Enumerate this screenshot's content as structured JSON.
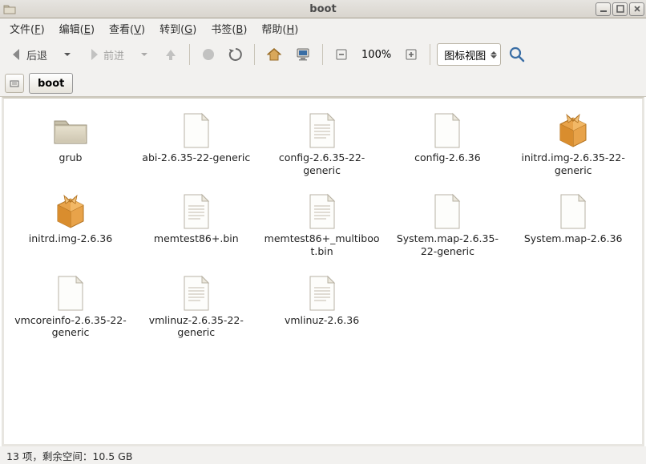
{
  "window": {
    "title": "boot"
  },
  "menu": {
    "items": [
      {
        "label": "文件",
        "accel": "F"
      },
      {
        "label": "编辑",
        "accel": "E"
      },
      {
        "label": "查看",
        "accel": "V"
      },
      {
        "label": "转到",
        "accel": "G"
      },
      {
        "label": "书签",
        "accel": "B"
      },
      {
        "label": "帮助",
        "accel": "H"
      }
    ]
  },
  "toolbar": {
    "back_label": "后退",
    "forward_label": "前进",
    "zoom_level": "100%",
    "view_mode": "图标视图"
  },
  "location": {
    "breadcrumb": "boot"
  },
  "files": [
    {
      "name": "grub",
      "type": "folder"
    },
    {
      "name": "abi-2.6.35-22-generic",
      "type": "file"
    },
    {
      "name": "config-2.6.35-22-generic",
      "type": "text"
    },
    {
      "name": "config-2.6.36",
      "type": "file"
    },
    {
      "name": "initrd.img-2.6.35-22-generic",
      "type": "package"
    },
    {
      "name": "initrd.img-2.6.36",
      "type": "package"
    },
    {
      "name": "memtest86+.bin",
      "type": "text"
    },
    {
      "name": "memtest86+_multiboot.bin",
      "type": "text"
    },
    {
      "name": "System.map-2.6.35-22-generic",
      "type": "file"
    },
    {
      "name": "System.map-2.6.36",
      "type": "file"
    },
    {
      "name": "vmcoreinfo-2.6.35-22-generic",
      "type": "file"
    },
    {
      "name": "vmlinuz-2.6.35-22-generic",
      "type": "text"
    },
    {
      "name": "vmlinuz-2.6.36",
      "type": "text"
    }
  ],
  "status": {
    "text": "13 项，剩余空间：10.5 GB"
  }
}
